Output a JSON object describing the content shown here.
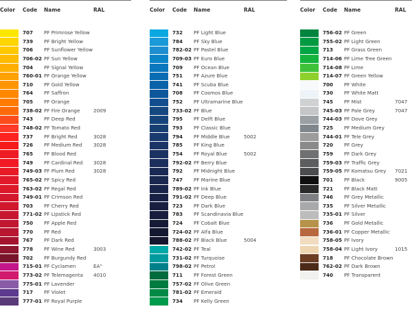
{
  "headers": {
    "color": "Color",
    "code": "Code",
    "name": "Name",
    "ral": "RAL"
  },
  "columns": [
    {
      "rows": [
        {
          "color": "#ffe600",
          "code": "707",
          "name": "PF Primrose Yellow",
          "ral": ""
        },
        {
          "color": "#ffd500",
          "code": "739",
          "name": "PF Bright Yellow",
          "ral": ""
        },
        {
          "color": "#ffc800",
          "code": "706",
          "name": "PF Sunflower Yellow",
          "ral": ""
        },
        {
          "color": "#ffbb00",
          "code": "706-02",
          "name": "PF Sun Yellow",
          "ral": ""
        },
        {
          "color": "#ffae00",
          "code": "704",
          "name": "PF Signal Yellow",
          "ral": ""
        },
        {
          "color": "#ffa100",
          "code": "760-01",
          "name": "PF Orange Yellow",
          "ral": ""
        },
        {
          "color": "#ff9500",
          "code": "710",
          "name": "PF Gold Yellow",
          "ral": ""
        },
        {
          "color": "#ff8800",
          "code": "764",
          "name": "PF Saffron",
          "ral": ""
        },
        {
          "color": "#ff7b00",
          "code": "705",
          "name": "PF Orange",
          "ral": ""
        },
        {
          "color": "#ff6a0a",
          "code": "738-02",
          "name": "PF Fire Orange",
          "ral": "2009"
        },
        {
          "color": "#ff4c1c",
          "code": "743",
          "name": "PF Deep Red",
          "ral": ""
        },
        {
          "color": "#ff3a28",
          "code": "748-02",
          "name": "PF Tomato Red",
          "ral": ""
        },
        {
          "color": "#ff2320",
          "code": "737",
          "name": "PF Bright Red",
          "ral": "3028"
        },
        {
          "color": "#f51b1b",
          "code": "726",
          "name": "PF Medium Red",
          "ral": "3028"
        },
        {
          "color": "#ee1c22",
          "code": "765",
          "name": "PF Blood Red",
          "ral": ""
        },
        {
          "color": "#f01924",
          "code": "749",
          "name": "PF Cardinal Red",
          "ral": "3028"
        },
        {
          "color": "#e81a26",
          "code": "749-03",
          "name": "PF Plum Red",
          "ral": "3028"
        },
        {
          "color": "#e1192a",
          "code": "765-02",
          "name": "PF Spicy Red",
          "ral": ""
        },
        {
          "color": "#dd1a2a",
          "code": "763-02",
          "name": "PF Regal Red",
          "ral": ""
        },
        {
          "color": "#d4182c",
          "code": "749-01",
          "name": "PF Crimson Red",
          "ral": ""
        },
        {
          "color": "#cf172e",
          "code": "703",
          "name": "PF Cherry Red",
          "ral": ""
        },
        {
          "color": "#c8162f",
          "code": "771-02",
          "name": "PF Lipstick Red",
          "ral": ""
        },
        {
          "color": "#c11730",
          "code": "750",
          "name": "PF Apple Red",
          "ral": ""
        },
        {
          "color": "#b81631",
          "code": "770",
          "name": "PF Red",
          "ral": ""
        },
        {
          "color": "#a5142f",
          "code": "767",
          "name": "PF Dark Red",
          "ral": ""
        },
        {
          "color": "#8e152d",
          "code": "778",
          "name": "PF Wine Red",
          "ral": "3003"
        },
        {
          "color": "#78152b",
          "code": "702",
          "name": "PF Burgundy Red",
          "ral": ""
        },
        {
          "color": "#c4168a",
          "code": "715-01",
          "name": "PF Cyclamen",
          "ral": "EA\""
        },
        {
          "color": "#d11a6e",
          "code": "773-02",
          "name": "PF Telemagenta",
          "ral": "4010"
        },
        {
          "color": "#8a5ca8",
          "code": "775-01",
          "name": "PF Lavender",
          "ral": ""
        },
        {
          "color": "#5c3a8e",
          "code": "717",
          "name": "PF Violet",
          "ral": ""
        },
        {
          "color": "#5a3b7a",
          "code": "777-01",
          "name": "PF Royal Purple",
          "ral": ""
        }
      ]
    },
    {
      "rows": [
        {
          "color": "#0aa8e0",
          "code": "732",
          "name": "PF Light Blue",
          "ral": ""
        },
        {
          "color": "#1a9ad8",
          "code": "784",
          "name": "PF Sky Blue",
          "ral": ""
        },
        {
          "color": "#1e8ed0",
          "code": "782-02",
          "name": "PF Pastel Blue",
          "ral": ""
        },
        {
          "color": "#0b84c8",
          "code": "709-03",
          "name": "PF Euro Blue",
          "ral": ""
        },
        {
          "color": "#0a78bd",
          "code": "709",
          "name": "PF Ocean Blue",
          "ral": ""
        },
        {
          "color": "#0a6db3",
          "code": "751",
          "name": "PF Azure Blue",
          "ral": ""
        },
        {
          "color": "#0a62a8",
          "code": "741",
          "name": "PF Scuba Blue",
          "ral": ""
        },
        {
          "color": "#0e579a",
          "code": "708",
          "name": "PF Cosmos Blue",
          "ral": ""
        },
        {
          "color": "#124e8f",
          "code": "752",
          "name": "PF Ultramarine Blue",
          "ral": ""
        },
        {
          "color": "#14487f",
          "code": "733-02",
          "name": "PF Blue",
          "ral": ""
        },
        {
          "color": "#16447a",
          "code": "795",
          "name": "PF Delft Blue",
          "ral": ""
        },
        {
          "color": "#173f72",
          "code": "793",
          "name": "PF Classic Blue",
          "ral": ""
        },
        {
          "color": "#193a6c",
          "code": "794",
          "name": "PF Middle Blue",
          "ral": "5002"
        },
        {
          "color": "#1a3566",
          "code": "785",
          "name": "PF King Blue",
          "ral": ""
        },
        {
          "color": "#1c3262",
          "code": "754",
          "name": "PF Royal Blue",
          "ral": "5002"
        },
        {
          "color": "#1c2e5c",
          "code": "792-02",
          "name": "PF Berry Blue",
          "ral": ""
        },
        {
          "color": "#1b2a55",
          "code": "792",
          "name": "PF Midnight Blue",
          "ral": ""
        },
        {
          "color": "#1a274f",
          "code": "747",
          "name": "PF Marine Blue",
          "ral": ""
        },
        {
          "color": "#19244a",
          "code": "789-02",
          "name": "PF Ink Blue",
          "ral": ""
        },
        {
          "color": "#182145",
          "code": "791-02",
          "name": "PF Deep Blue",
          "ral": ""
        },
        {
          "color": "#171e40",
          "code": "723",
          "name": "PF Dark Blue",
          "ral": ""
        },
        {
          "color": "#161c3b",
          "code": "783",
          "name": "PF Scandinavia Blue",
          "ral": ""
        },
        {
          "color": "#151a36",
          "code": "724",
          "name": "PF Cobalt Blue",
          "ral": ""
        },
        {
          "color": "#141831",
          "code": "724-02",
          "name": "PF Alfa Blue",
          "ral": ""
        },
        {
          "color": "#13162c",
          "code": "788-02",
          "name": "PF Black Blue",
          "ral": "5004"
        },
        {
          "color": "#00a8a8",
          "code": "742-02",
          "name": "PF Teal",
          "ral": ""
        },
        {
          "color": "#009a9e",
          "code": "731-02",
          "name": "PF Turquoise",
          "ral": ""
        },
        {
          "color": "#00808a",
          "code": "798-02",
          "name": "PF Petrol",
          "ral": ""
        },
        {
          "color": "#006b3c",
          "code": "711",
          "name": "PF Forest Green",
          "ral": ""
        },
        {
          "color": "#007a40",
          "code": "757-02",
          "name": "PF Olive Green",
          "ral": ""
        },
        {
          "color": "#008a46",
          "code": "781-02",
          "name": "PF Emerald",
          "ral": ""
        },
        {
          "color": "#009a4c",
          "code": "734",
          "name": "PF Kelly Green",
          "ral": ""
        }
      ]
    },
    {
      "rows": [
        {
          "color": "#00843e",
          "code": "756-02",
          "name": "PF Green",
          "ral": ""
        },
        {
          "color": "#009a42",
          "code": "755-02",
          "name": "PF Light Green",
          "ral": ""
        },
        {
          "color": "#00a544",
          "code": "713",
          "name": "PF Grass Green",
          "ral": ""
        },
        {
          "color": "#14b43e",
          "code": "714-06",
          "name": "PF Lime Tree Green",
          "ral": ""
        },
        {
          "color": "#3fc23a",
          "code": "714-08",
          "name": "PF Lime",
          "ral": ""
        },
        {
          "color": "#8fd12c",
          "code": "714-07",
          "name": "PF Green Yellow",
          "ral": ""
        },
        {
          "color": "#f7f9fa",
          "code": "700",
          "name": "PF White",
          "ral": ""
        },
        {
          "color": "#eef3f8",
          "code": "730",
          "name": "PF White Matt",
          "ral": ""
        },
        {
          "color": "#cfd1d3",
          "code": "745",
          "name": "PF Mist",
          "ral": "7047"
        },
        {
          "color": "#c4c6c8",
          "code": "745-03",
          "name": "PF Pale Grey",
          "ral": "7047"
        },
        {
          "color": "#9aa0a3",
          "code": "744-03",
          "name": "PF Dove Grey",
          "ral": ""
        },
        {
          "color": "#7f878d",
          "code": "725",
          "name": "PF Medium Grey",
          "ral": ""
        },
        {
          "color": "#9c9c9c",
          "code": "744-01",
          "name": "PF Tele Grey",
          "ral": ""
        },
        {
          "color": "#8a8a8a",
          "code": "720",
          "name": "PF Grey",
          "ral": ""
        },
        {
          "color": "#6f7072",
          "code": "759",
          "name": "PF Dark Grey",
          "ral": ""
        },
        {
          "color": "#5b5d5f",
          "code": "759-03",
          "name": "PF Traffic Grey",
          "ral": ""
        },
        {
          "color": "#4a4c4e",
          "code": "759-05",
          "name": "PF Komatsu Grey",
          "ral": "7021"
        },
        {
          "color": "#101010",
          "code": "701",
          "name": "PF Black",
          "ral": "9005"
        },
        {
          "color": "#2a2a2a",
          "code": "721",
          "name": "PF Black Matt",
          "ral": ""
        },
        {
          "color": "#7d7f82",
          "code": "746",
          "name": "PF Grey Metallic",
          "ral": ""
        },
        {
          "color": "#a8a9ab",
          "code": "735",
          "name": "PF Silver Metallic",
          "ral": ""
        },
        {
          "color": "#bcbcbc",
          "code": "735-01",
          "name": "PF Silver",
          "ral": ""
        },
        {
          "color": "#b7924a",
          "code": "736",
          "name": "PF Gold Metallic",
          "ral": ""
        },
        {
          "color": "#b8683f",
          "code": "736-01",
          "name": "PF Copper Metallic",
          "ral": ""
        },
        {
          "color": "#f2dcc0",
          "code": "758-05",
          "name": "PF Ivory",
          "ral": ""
        },
        {
          "color": "#efd6b2",
          "code": "758-04",
          "name": "PF Light Ivory",
          "ral": "1015"
        },
        {
          "color": "#6b3d24",
          "code": "718",
          "name": "PF Chocolate Brown",
          "ral": ""
        },
        {
          "color": "#4c2a1a",
          "code": "762-02",
          "name": "PF Dark Brown",
          "ral": ""
        },
        {
          "color": "#f1f2ef",
          "code": "740",
          "name": "PF Transparent",
          "ral": ""
        }
      ]
    }
  ]
}
